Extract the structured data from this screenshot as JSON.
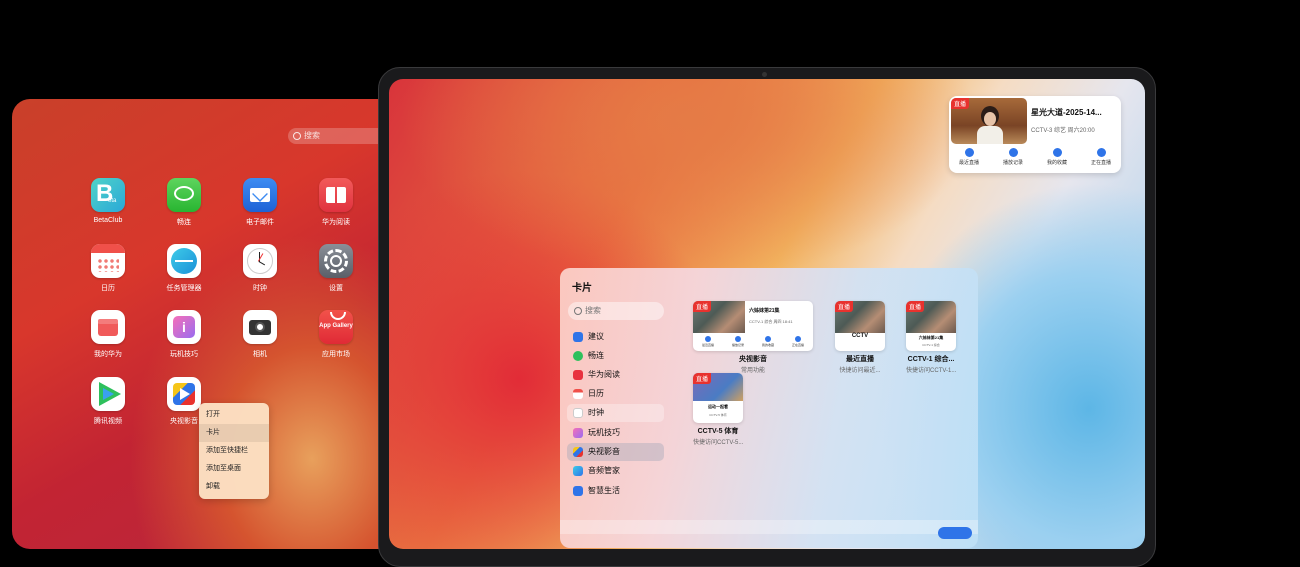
{
  "left_tablet": {
    "search_placeholder": "搜索",
    "apps": [
      {
        "label": "BetaClub"
      },
      {
        "label": "畅连"
      },
      {
        "label": "电子邮件"
      },
      {
        "label": "华为阅读"
      },
      {
        "label": "日历"
      },
      {
        "label": "任务管理器"
      },
      {
        "label": "时钟"
      },
      {
        "label": "设置"
      },
      {
        "label": "我的华为"
      },
      {
        "label": "玩机技巧"
      },
      {
        "label": "相机"
      },
      {
        "label": "应用市场",
        "icon_text": "App Gallery"
      },
      {
        "label": "腾讯视频"
      },
      {
        "label": "央视影音"
      }
    ],
    "context_menu": [
      "打开",
      "卡片",
      "添加至快捷栏",
      "添加至桌面",
      "卸载"
    ]
  },
  "widget": {
    "badge": "直播",
    "title": "星光大道-2025-14...",
    "subtitle": "CCTV-3 综艺  周六20:00",
    "buttons": [
      "最近直播",
      "播放记录",
      "我的收藏",
      "正在直播"
    ]
  },
  "panel": {
    "title": "卡片",
    "search_placeholder": "搜索",
    "sidebar": [
      "建议",
      "畅连",
      "华为阅读",
      "日历",
      "时钟",
      "玩机技巧",
      "央视影音",
      "音频管家",
      "智慧生活"
    ],
    "cards": [
      {
        "name": "央视影音",
        "sub": "常用功能",
        "badge": "直播",
        "inner_title": "六姊妹第21集",
        "inner_sub": "CCTV-1 综合 周四 18:41",
        "buttons": [
          "最近直播",
          "播放记录",
          "我的收藏",
          "正在直播"
        ]
      },
      {
        "name": "最近直播",
        "sub": "快捷访问最近...",
        "badge": "直播",
        "logo": "CCTV"
      },
      {
        "name": "CCTV-1 综合...",
        "sub": "快捷访问CCTV-1...",
        "badge": "直播",
        "inner_title": "六姊妹第21集",
        "inner_sub": "CCTV-1 综合"
      },
      {
        "name": "CCTV-5 体育",
        "sub": "快捷访问CCTV-5...",
        "badge": "直播",
        "inner_title": "运动一起看",
        "inner_sub": "CCTV-5 体育"
      }
    ]
  },
  "colors": {
    "accent": "#2f74e8",
    "live_red": "#e8322e"
  }
}
